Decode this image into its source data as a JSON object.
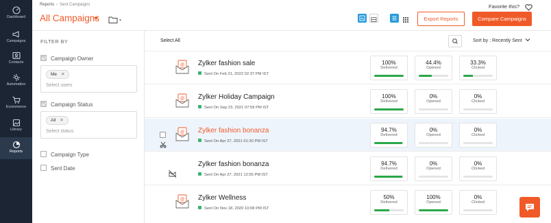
{
  "nav": {
    "items": [
      {
        "label": "Dashboard",
        "icon": "dashboard-icon"
      },
      {
        "label": "Campaigns",
        "icon": "megaphone-icon"
      },
      {
        "label": "Contacts",
        "icon": "contacts-icon"
      },
      {
        "label": "Automation",
        "icon": "automation-icon"
      },
      {
        "label": "Ecommerce",
        "icon": "cart-icon"
      },
      {
        "label": "Library",
        "icon": "library-icon"
      },
      {
        "label": "Reports",
        "icon": "reports-icon"
      }
    ],
    "active": "Reports"
  },
  "header": {
    "breadcrumb_parent": "Reports",
    "breadcrumb_sep": "›",
    "breadcrumb_current": "Sent Campaigns",
    "title": "All Campaigns",
    "favorite_label": "Favorite this?",
    "export_label": "Export Reports",
    "compare_label": "Compare Campaigns"
  },
  "filters": {
    "heading": "FILTER BY",
    "owner_label": "Campaign Owner",
    "owner_chip": "Me",
    "owner_placeholder": "Select users",
    "status_label": "Campaign Status",
    "status_chip": "All",
    "status_placeholder": "Select status",
    "type_label": "Campaign Type",
    "date_label": "Sent Date",
    "chip_remove": "✕"
  },
  "list": {
    "select_all": "Select All",
    "sort_label": "Sort by : Recently Sent",
    "rows": [
      {
        "name": "Zylker fashion sale",
        "sent": "Sent On Feb 21, 2022 02:37 PM IST",
        "delivered": "100%",
        "delivered_label": "Delivered",
        "delivered_fill": 1.0,
        "opened": "44.4%",
        "opened_label": "Opened",
        "opened_fill": 0.444,
        "clicked": "33.3%",
        "clicked_label": "Clicked",
        "clicked_fill": 0.333
      },
      {
        "name": "Zylker Holiday Campaign",
        "sent": "Sent On Sep 23, 2021 07:59 PM IST",
        "delivered": "100%",
        "delivered_label": "Delivered",
        "delivered_fill": 1.0,
        "opened": "0%",
        "opened_label": "Opened",
        "opened_fill": 0,
        "clicked": "0%",
        "clicked_label": "Clicked",
        "clicked_fill": 0
      },
      {
        "name": "Zylker fashion bonanza",
        "sent": "Sent On Apr 27, 2021 01:30 PM IST",
        "delivered": "94.7%",
        "delivered_label": "Delivered",
        "delivered_fill": 0.947,
        "opened": "0%",
        "opened_label": "Opened",
        "opened_fill": 0,
        "clicked": "0%",
        "clicked_label": "Clicked",
        "clicked_fill": 0
      },
      {
        "name": "Zylker fashion bonanza",
        "sent": "Sent On Apr 27, 2021 12:55 PM IST",
        "delivered": "94.7%",
        "delivered_label": "Delivered",
        "delivered_fill": 0.947,
        "opened": "0%",
        "opened_label": "Opened",
        "opened_fill": 0,
        "clicked": "0%",
        "clicked_label": "Clicked",
        "clicked_fill": 0
      },
      {
        "name": "Zylker Wellness",
        "sent": "Sent On Nov 18, 2020 10:08 PM IST",
        "delivered": "50%",
        "delivered_label": "Delivered",
        "delivered_fill": 0.5,
        "opened": "100%",
        "opened_label": "Opened",
        "opened_fill": 1.0,
        "clicked": "0%",
        "clicked_label": "Clicked",
        "clicked_fill": 0
      }
    ]
  },
  "colors": {
    "accent": "#f05a28",
    "nav_bg": "#1b2533",
    "toggle_blue": "#2a9bdb",
    "progress_green": "#2aa84a",
    "sent_green": "#3cb371"
  }
}
